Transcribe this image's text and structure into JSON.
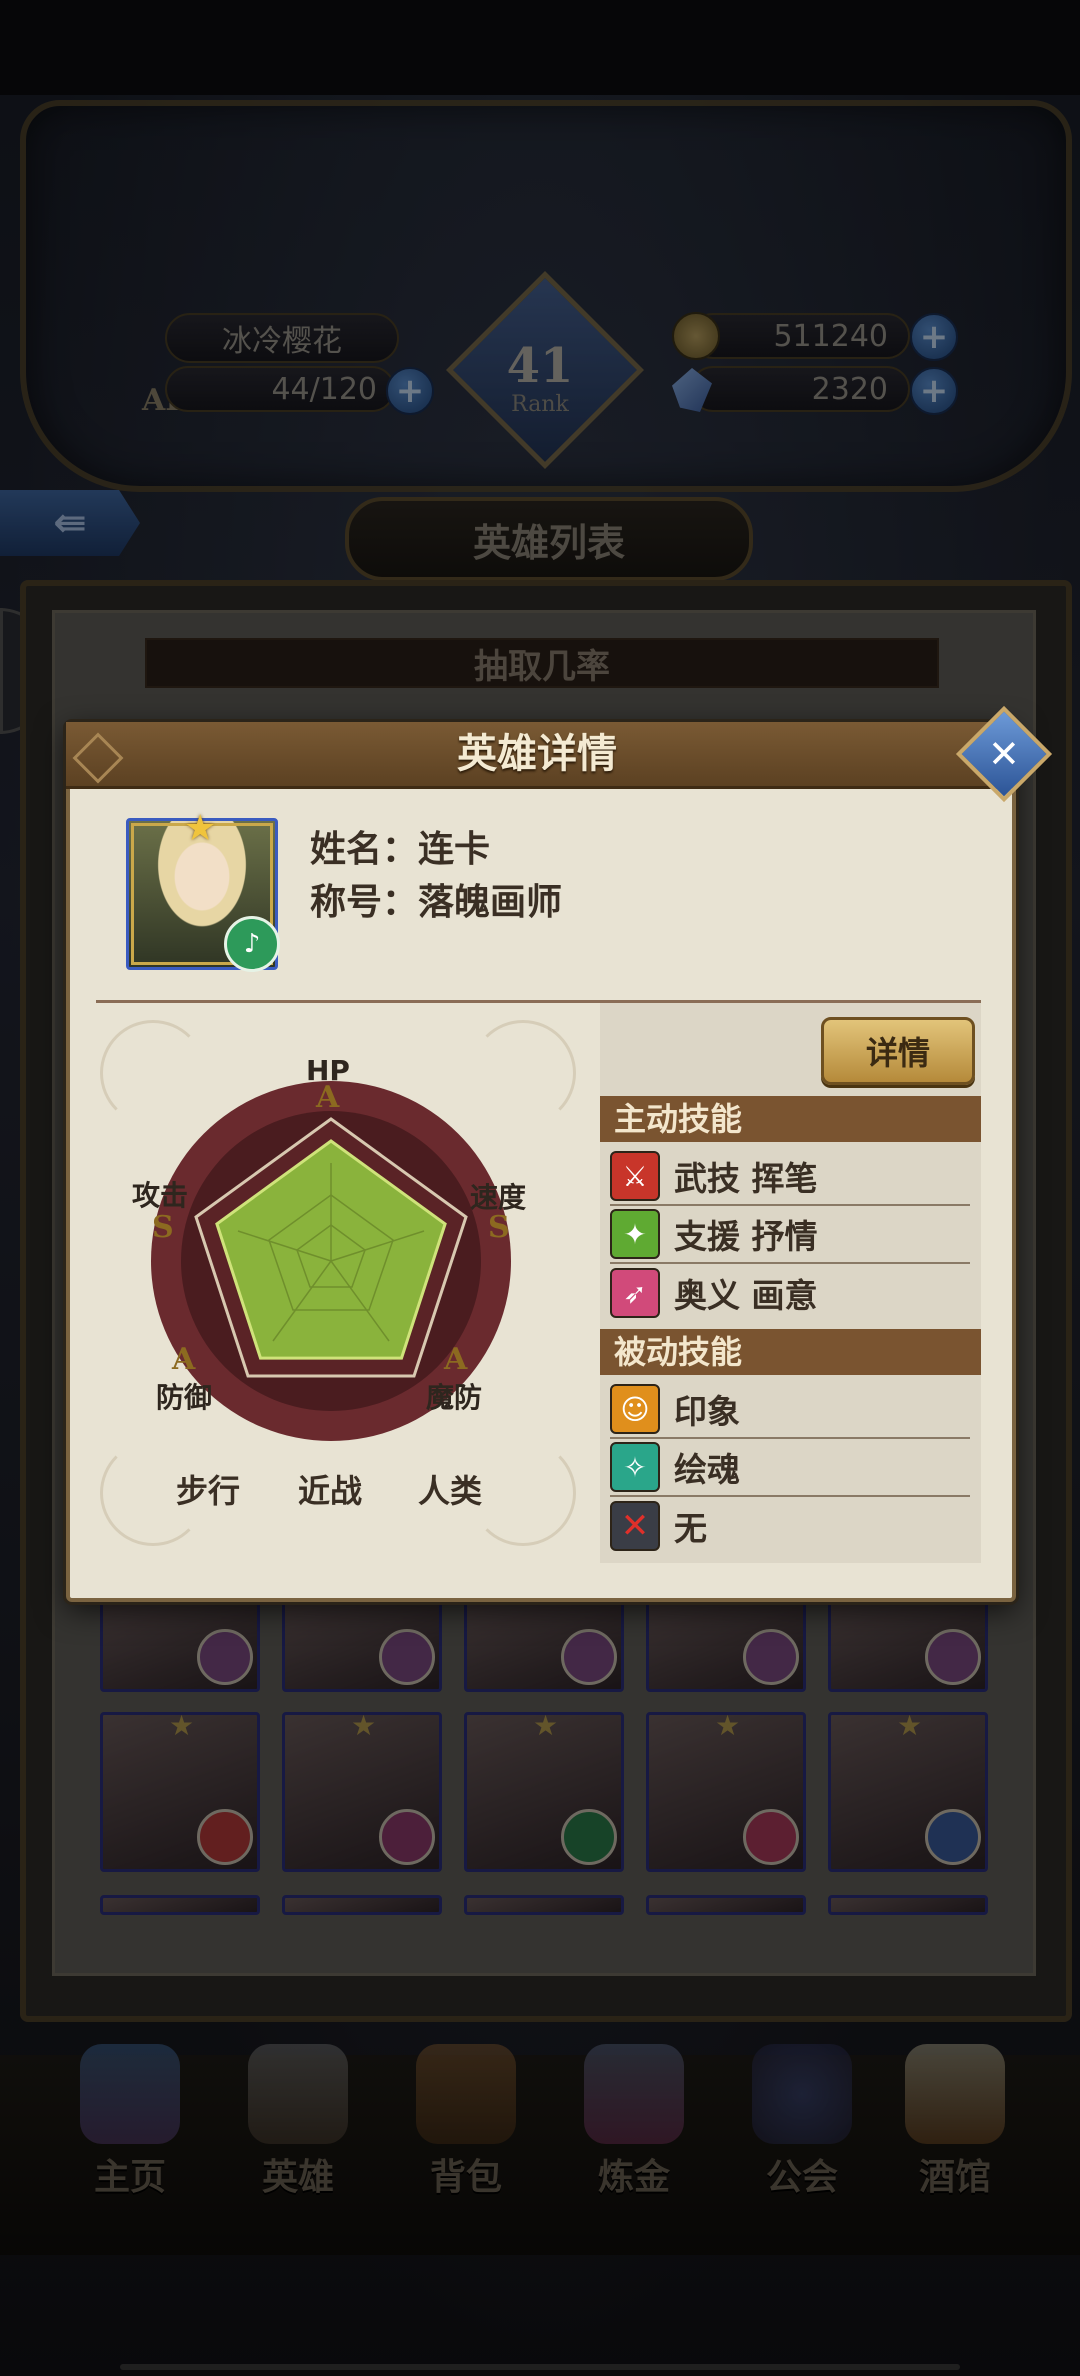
{
  "top_bar": {
    "player_name": "冰冷樱花",
    "ap_label": "AP",
    "ap_value": "44/120",
    "gold": "511240",
    "gems": "2320",
    "rank_number": "41",
    "rank_word": "Rank",
    "plus": "+"
  },
  "page": {
    "title": "英雄列表",
    "back_symbol": "⇚",
    "side_tab_symbol": "›"
  },
  "list_panel": {
    "rate_title": "抽取几率"
  },
  "modal": {
    "title": "英雄详情",
    "name_label": "姓名：",
    "name_value": "连卡",
    "title_label": "称号：",
    "title_value": "落魄画师",
    "close_symbol": "✕",
    "details_button": "详情",
    "radar": {
      "hp_label": "HP",
      "hp_grade": "A",
      "speed_label": "速度",
      "speed_grade": "S",
      "mdef_label": "魔防",
      "mdef_grade": "A",
      "def_label": "防御",
      "def_grade": "A",
      "atk_label": "攻击",
      "atk_grade": "S"
    },
    "traits": [
      "步行",
      "近战",
      "人类"
    ],
    "active_skills_header": "主动技能",
    "active_skills": [
      {
        "label": "武技 挥笔",
        "icon": "sword-skill-icon",
        "color": "#c8352a"
      },
      {
        "label": "支援 抒情",
        "icon": "support-skill-icon",
        "color": "#5faa32"
      },
      {
        "label": "奥义 画意",
        "icon": "ultimate-skill-icon",
        "color": "#d14a7a"
      }
    ],
    "passive_skills_header": "被动技能",
    "passive_skills": [
      {
        "label": "印象",
        "icon": "impression-skill-icon",
        "color": "#e08f1c"
      },
      {
        "label": "绘魂",
        "icon": "soul-skill-icon",
        "color": "#2aa68a"
      },
      {
        "label": "无",
        "icon": "none-x-icon",
        "color": "#3a3d46"
      }
    ]
  },
  "bottom_nav": [
    "主页",
    "英雄",
    "背包",
    "炼金",
    "公会",
    "酒馆"
  ],
  "colors": {
    "modal_bg": "#e8e3d3",
    "header_brown": "#7a5430",
    "radar_fill": "#8ab33c"
  }
}
